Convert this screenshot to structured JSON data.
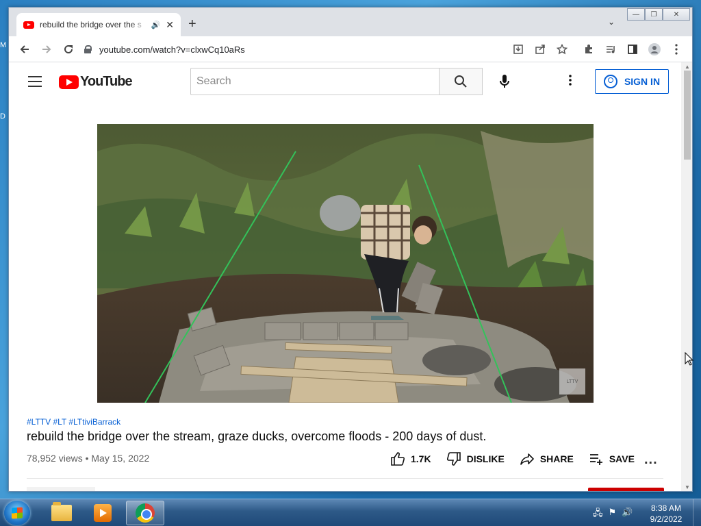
{
  "desktop": {
    "label_1": "M",
    "label_2": "D"
  },
  "browser": {
    "tab": {
      "title": "rebuild the bridge over the s",
      "audio_icon": "speaker-icon",
      "close": "✕"
    },
    "new_tab": "+",
    "url": "youtube.com/watch?v=clxwCq10aRs",
    "window_controls": [
      "minimize",
      "restore",
      "close"
    ]
  },
  "youtube": {
    "logo_text": "YouTube",
    "search_placeholder": "Search",
    "sign_in": "SIGN IN",
    "video": {
      "hashtags": "#LTTV #LT #LTtiviBarrack",
      "title": "rebuild the bridge over the stream, graze ducks, overcome floods - 200 days of dust.",
      "meta": "78,952 views • May 15, 2022",
      "likes": "1.7K",
      "dislike": "DISLIKE",
      "share": "SHARE",
      "save": "SAVE",
      "more": "..."
    }
  },
  "taskbar": {
    "time": "8:38 AM",
    "date": "9/2/2022",
    "apps": [
      "windows-explorer",
      "media-player",
      "google-chrome"
    ]
  }
}
